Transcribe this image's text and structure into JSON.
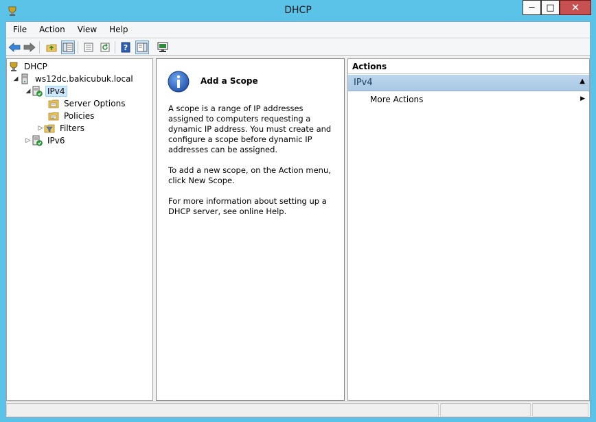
{
  "window": {
    "title": "DHCP"
  },
  "menu": [
    "File",
    "Action",
    "View",
    "Help"
  ],
  "toolbar": {
    "icons": [
      "back-arrow-icon",
      "forward-arrow-icon",
      "up-folder-icon",
      "show-tree-icon",
      "properties-icon",
      "refresh-icon",
      "help-icon",
      "action-pane-icon",
      "server-display-icon"
    ]
  },
  "tree": {
    "root": "DHCP",
    "server": "ws12dc.bakicubuk.local",
    "ipv4": "IPv4",
    "server_options": "Server Options",
    "policies": "Policies",
    "filters": "Filters",
    "ipv6": "IPv6"
  },
  "result": {
    "title": "Add a Scope",
    "p1": "A scope is a range of IP addresses assigned to computers requesting a dynamic IP address. You must create and configure a scope before dynamic IP addresses can be assigned.",
    "p2": "To add a new scope, on the Action menu, click New Scope.",
    "p3": "For more information about setting up a DHCP server, see online Help."
  },
  "actions": {
    "header": "Actions",
    "group": "IPv4",
    "more_actions": "More Actions"
  },
  "colors": {
    "titlebar": "#5bc3e8",
    "close_button": "#c75050",
    "selection": "#cce8ff",
    "actions_group": "#bcd6ec"
  }
}
